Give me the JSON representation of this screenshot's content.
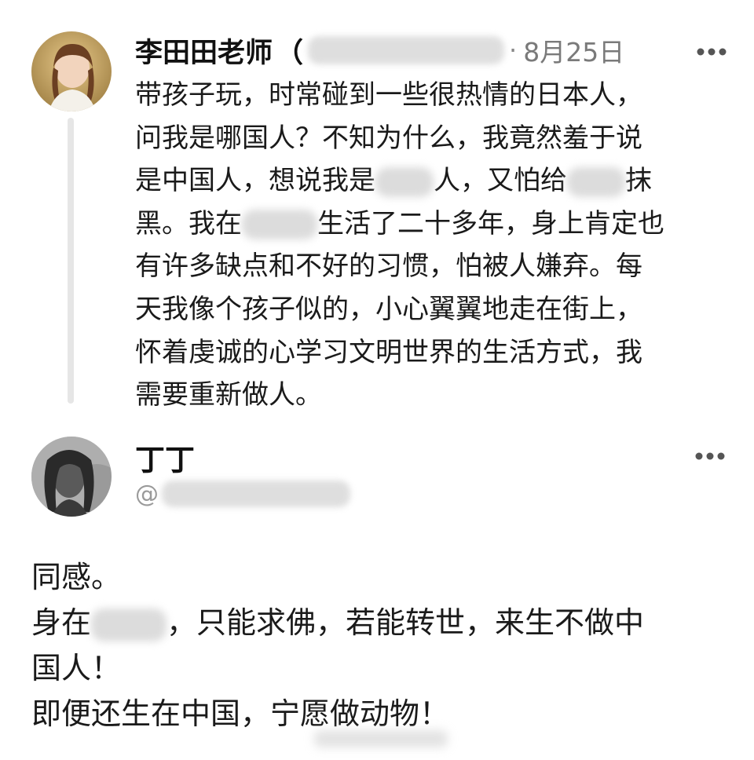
{
  "post": {
    "author_name": "李田田老师",
    "author_paren": "（",
    "separator": "·",
    "date": "8月25日",
    "lines": [
      [
        "带孩子玩，时常碰到一些很热情的日本人，"
      ],
      [
        "问我是哪国人？不知为什么，我竟然羞于说"
      ],
      [
        "是中国人，想说我是",
        "人，又怕给",
        "抹"
      ],
      [
        "黑。我在",
        "生活了二十多年，身上肯定也"
      ],
      [
        "有许多缺点和不好的习惯，怕被人嫌弃。每"
      ],
      [
        "天我像个孩子似的，小心翼翼地走在街上，"
      ],
      [
        "怀着虔诚的心学习文明世界的生活方式，我"
      ],
      [
        "需要重新做人。"
      ]
    ],
    "more_icon": "more-horizontal-icon",
    "avatar_icon": "avatar-photo"
  },
  "reply": {
    "author_name": "丁丁",
    "handle_prefix": "@",
    "more_icon": "more-horizontal-icon",
    "avatar_icon": "avatar-photo",
    "lines": [
      [
        "同感。"
      ],
      [
        "身在",
        "，只能求佛，若能转世，来生不做中"
      ],
      [
        "国人！"
      ],
      [
        "即便还生在中国，宁愿做动物！"
      ]
    ]
  },
  "colors": {
    "text": "#1a1a1a",
    "muted": "#7a7a7a",
    "thread_line": "#e6e6e6",
    "blur": "#d9d9d9"
  }
}
